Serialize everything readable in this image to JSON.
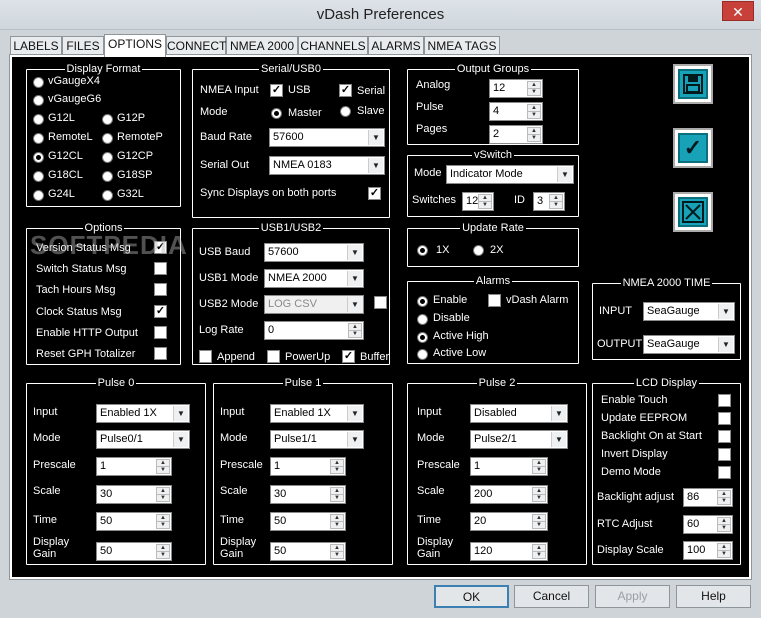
{
  "window": {
    "title": "vDash Preferences",
    "close": "✕"
  },
  "tabs": [
    "LABELS",
    "FILES",
    "OPTIONS",
    "CONNECT",
    "NMEA 2000",
    "CHANNELS",
    "ALARMS",
    "NMEA TAGS"
  ],
  "display_format": {
    "title": "Display Format",
    "options": [
      "vGaugeX4",
      "vGaugeG6",
      "G12L",
      "G12P",
      "RemoteL",
      "RemoteP",
      "G12CL",
      "G12CP",
      "G18CL",
      "G18SP",
      "G24L",
      "G32L"
    ],
    "selected": "G12CL"
  },
  "serial_usb0": {
    "title": "Serial/USB0",
    "nmea_input_label": "NMEA Input",
    "usb_label": "USB",
    "serial_label": "Serial",
    "mode_label": "Mode",
    "master_label": "Master",
    "slave_label": "Slave",
    "baud_label": "Baud Rate",
    "baud_value": "57600",
    "serial_out_label": "Serial Out",
    "serial_out_value": "NMEA 0183",
    "sync_label": "Sync Displays on both ports"
  },
  "output_groups": {
    "title": "Output Groups",
    "analog_label": "Analog",
    "analog_value": "12",
    "pulse_label": "Pulse",
    "pulse_value": "4",
    "pages_label": "Pages",
    "pages_value": "2"
  },
  "vswitch": {
    "title": "vSwitch",
    "mode_label": "Mode",
    "mode_value": "Indicator Mode",
    "switches_label": "Switches",
    "switches_value": "12",
    "id_label": "ID",
    "id_value": "3"
  },
  "options": {
    "title": "Options",
    "items": [
      {
        "label": "Version Status Msg",
        "checked": true
      },
      {
        "label": "Switch Status Msg",
        "checked": false
      },
      {
        "label": "Tach Hours Msg",
        "checked": false
      },
      {
        "label": "Clock Status Msg",
        "checked": true
      },
      {
        "label": "Enable HTTP Output",
        "checked": false
      },
      {
        "label": "Reset GPH Totalizer",
        "checked": false
      }
    ]
  },
  "usb1_usb2": {
    "title": "USB1/USB2",
    "usb_baud_label": "USB Baud",
    "usb_baud_value": "57600",
    "usb1_mode_label": "USB1 Mode",
    "usb1_mode_value": "NMEA 2000",
    "usb2_mode_label": "USB2 Mode",
    "usb2_mode_value": "LOG CSV",
    "log_rate_label": "Log Rate",
    "log_rate_value": "0",
    "append_label": "Append",
    "powerup_label": "PowerUp",
    "buffer_label": "Buffer"
  },
  "update_rate": {
    "title": "Update Rate",
    "opt1": "1X",
    "opt2": "2X"
  },
  "alarms": {
    "title": "Alarms",
    "enable": "Enable",
    "disable": "Disable",
    "active_high": "Active High",
    "active_low": "Active Low",
    "vdash_alarm": "vDash Alarm"
  },
  "nmea2000_time": {
    "title": "NMEA 2000 TIME",
    "input_label": "INPUT",
    "input_value": "SeaGauge",
    "output_label": "OUTPUT",
    "output_value": "SeaGauge"
  },
  "pulses": [
    {
      "title": "Pulse 0",
      "input": "Enabled 1X",
      "mode": "Pulse0/1",
      "prescale": "1",
      "scale": "30",
      "time": "50",
      "gain": "50"
    },
    {
      "title": "Pulse 1",
      "input": "Enabled 1X",
      "mode": "Pulse1/1",
      "prescale": "1",
      "scale": "30",
      "time": "50",
      "gain": "50"
    },
    {
      "title": "Pulse 2",
      "input": "Disabled",
      "mode": "Pulse2/1",
      "prescale": "1",
      "scale": "200",
      "time": "20",
      "gain": "120"
    }
  ],
  "pulse_labels": {
    "input": "Input",
    "mode": "Mode",
    "prescale": "Prescale",
    "scale": "Scale",
    "time": "Time",
    "gain1": "Display",
    "gain2": "Gain"
  },
  "lcd_display": {
    "title": "LCD Display",
    "enable_touch": "Enable Touch",
    "update_eeprom": "Update EEPROM",
    "backlight_on_start": "Backlight On at Start",
    "invert_display": "Invert Display",
    "demo_mode": "Demo Mode",
    "backlight_adjust_label": "Backlight adjust",
    "backlight_adjust_value": "86",
    "rtc_adjust_label": "RTC Adjust",
    "rtc_adjust_value": "60",
    "display_scale_label": "Display Scale",
    "display_scale_value": "100"
  },
  "buttons": {
    "ok": "OK",
    "cancel": "Cancel",
    "apply": "Apply",
    "help": "Help"
  },
  "watermark": "SOFTPEDIA",
  "colors": {
    "panel_bg": "#000000",
    "icon_teal": "#17a2b8",
    "selection_blue": "#3a72c4"
  }
}
